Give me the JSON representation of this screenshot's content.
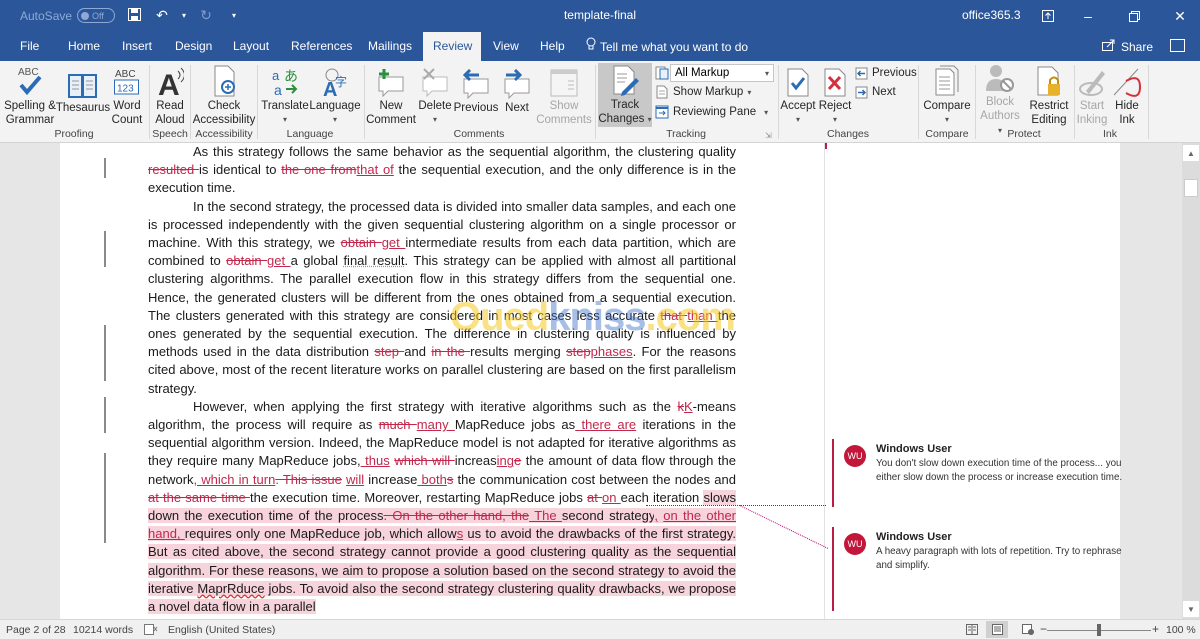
{
  "titlebar": {
    "autosave_label": "AutoSave",
    "autosave_state": "Off",
    "document_title": "template-final",
    "account": "office365.3",
    "icons": [
      "save-icon",
      "undo-icon",
      "redo-icon",
      "customize-qat-icon",
      "ribbon-display-icon",
      "minimize-icon",
      "restore-icon",
      "close-icon"
    ]
  },
  "tabs": {
    "items": [
      "File",
      "Home",
      "Insert",
      "Design",
      "Layout",
      "References",
      "Mailings",
      "Review",
      "View",
      "Help"
    ],
    "active": "Review",
    "tell_me": "Tell me what you want to do",
    "share": "Share"
  },
  "ribbon": {
    "groups": {
      "proofing": "Proofing",
      "speech": "Speech",
      "accessibility": "Accessibility",
      "language": "Language",
      "comments": "Comments",
      "tracking": "Tracking",
      "changes": "Changes",
      "compare": "Compare",
      "protect": "Protect",
      "ink": "Ink"
    },
    "buttons": {
      "spelling": [
        "Spelling &",
        "Grammar"
      ],
      "thesaurus": "Thesaurus",
      "word_count": [
        "Word",
        "Count"
      ],
      "read_aloud": [
        "Read",
        "Aloud"
      ],
      "check_accessibility": [
        "Check",
        "Accessibility"
      ],
      "translate": "Translate",
      "language": "Language",
      "new_comment": [
        "New",
        "Comment"
      ],
      "delete": "Delete",
      "previous": "Previous",
      "next": "Next",
      "show_comments": [
        "Show",
        "Comments"
      ],
      "track_changes": [
        "Track",
        "Changes"
      ],
      "markup_dropdown": "All Markup",
      "show_markup": "Show Markup",
      "reviewing_pane": "Reviewing Pane",
      "accept": "Accept",
      "reject": "Reject",
      "changes_previous": "Previous",
      "changes_next": "Next",
      "compare": "Compare",
      "block_authors": [
        "Block",
        "Authors"
      ],
      "restrict_editing": [
        "Restrict",
        "Editing"
      ],
      "start_inking": [
        "Start",
        "Inking"
      ],
      "hide_ink": [
        "Hide",
        "Ink"
      ]
    },
    "icon_labels": {
      "abc": "ABC",
      "abc123_top": "ABC",
      "abc123_bottom": "123"
    }
  },
  "document": {
    "paragraphs": [
      [
        {
          "t": "As this strategy follows the same behavior as the sequential algorithm, the clustering quality "
        },
        {
          "t": "resulted ",
          "k": "del"
        },
        {
          "t": "is identical to "
        },
        {
          "t": "the one from",
          "k": "del"
        },
        {
          "t": "that of",
          "k": "ins"
        },
        {
          "t": " the sequential execution, and the only difference is in the execution time."
        }
      ],
      [
        {
          "t": "In the second strategy, the processed data is divided into smaller data samples, and each one is processed independently with the given sequential clustering algorithm on a single processor or machine. With this strategy, we "
        },
        {
          "t": "obtain ",
          "k": "del"
        },
        {
          "t": "get ",
          "k": "ins"
        },
        {
          "t": "intermediate results from each data partition, which are combined to "
        },
        {
          "t": "obtain ",
          "k": "del"
        },
        {
          "t": "get ",
          "k": "ins"
        },
        {
          "t": "a global "
        },
        {
          "t": "final result",
          "k": "sq"
        },
        {
          "t": ". This strategy can be applied with almost all partitional clustering algorithms. The parallel execution flow in this strategy differs from the sequential one. Hence, the generated clusters will be different from the ones obtained from a sequential execution. The clusters generated with this strategy are considered in most cases less accurate "
        },
        {
          "t": "that ",
          "k": "del"
        },
        {
          "t": "than ",
          "k": "ins"
        },
        {
          "t": "the ones generated by the sequential execution. The difference in clustering quality is influenced by methods used in the data distribution "
        },
        {
          "t": "step ",
          "k": "del"
        },
        {
          "t": "and "
        },
        {
          "t": "in the ",
          "k": "del"
        },
        {
          "t": "results merging "
        },
        {
          "t": "step",
          "k": "del"
        },
        {
          "t": "phases",
          "k": "ins"
        },
        {
          "t": ". For the reasons cited above, most of the recent literature works on parallel clustering are based on the first parallelism strategy."
        }
      ],
      [
        {
          "t": "However, when applying the first strategy with iterative algorithms such as the "
        },
        {
          "t": "k",
          "k": "del"
        },
        {
          "t": "K",
          "k": "ins"
        },
        {
          "t": "-means algorithm, the process will require as "
        },
        {
          "t": "much ",
          "k": "del"
        },
        {
          "t": "many ",
          "k": "ins"
        },
        {
          "t": "MapReduce jobs as"
        },
        {
          "t": " there are",
          "k": "ins"
        },
        {
          "t": " iterations in the sequential algorithm version. Indeed, the MapReduce model is not adapted for iterative algorithms as they require many MapReduce jobs,"
        },
        {
          "t": " thus",
          "k": "ins"
        },
        {
          "t": " "
        },
        {
          "t": "which will ",
          "k": "del"
        },
        {
          "t": "increas"
        },
        {
          "t": "ing",
          "k": "ins"
        },
        {
          "t": "e",
          "k": "del"
        },
        {
          "t": " the amount of data flow through the network"
        },
        {
          "t": ", which in turn",
          "k": "ins"
        },
        {
          "t": ". This issue",
          "k": "del"
        },
        {
          "t": " "
        },
        {
          "t": "will",
          "k": "ins"
        },
        {
          "t": " increase"
        },
        {
          "t": " both",
          "k": "ins"
        },
        {
          "t": "s",
          "k": "del"
        },
        {
          "t": " the communication cost between the nodes and "
        },
        {
          "t": "at the same time ",
          "k": "del"
        },
        {
          "t": "the execution time. Moreover, restarting MapReduce jobs "
        },
        {
          "t": "at ",
          "k": "del"
        },
        {
          "t": "on ",
          "k": "ins"
        },
        {
          "t": "each iteration "
        },
        {
          "t": "slows down the execution time of the process",
          "k": "hl"
        },
        {
          "t": ". On the other hand, ",
          "k": "hl del"
        },
        {
          "t": "the",
          "k": "hl del"
        },
        {
          "t": " The ",
          "k": "hl ins"
        },
        {
          "t": "second strategy",
          "k": "hl"
        },
        {
          "t": ",",
          "k": "hl ins"
        },
        {
          "t": " ",
          "k": "hl"
        },
        {
          "t": "on the other hand, ",
          "k": "hl ins"
        },
        {
          "t": "requires only one MapReduce job, which allow",
          "k": "hl"
        },
        {
          "t": "s",
          "k": "hl ins"
        },
        {
          "t": " us to avoid the drawbacks of the first strategy. But as cited above, the second strategy cannot provide a good clustering quality as the sequential algorithm. For these reasons, we aim to propose a solution based on the second strategy to avoid the iterative ",
          "k": "hl"
        },
        {
          "t": "MaprRduce",
          "k": "hl sp"
        },
        {
          "t": " jobs. To avoid also the second strategy clustering quality drawbacks, we propose a novel data flow in a parallel",
          "k": "hl"
        }
      ]
    ]
  },
  "comments": [
    {
      "initials": "WU",
      "author": "Windows User",
      "text": "You don't slow down execution time of the process... you either slow down the process or increase execution time."
    },
    {
      "initials": "WU",
      "author": "Windows User",
      "text": "A heavy paragraph with lots of repetition. Try to rephrase and simplify."
    }
  ],
  "statusbar": {
    "page": "Page 2 of 28",
    "words": "10214 words",
    "language": "English (United States)",
    "zoom_minus": "−",
    "zoom_plus": "+",
    "zoom_level": "100 %",
    "zoom_percent": 100
  },
  "watermark": {
    "a": "Oued",
    "b": "kniss",
    "c": ".com"
  }
}
